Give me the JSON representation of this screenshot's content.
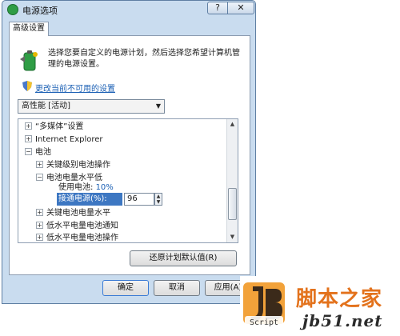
{
  "window": {
    "title": "电源选项",
    "help": "?",
    "close": "✕"
  },
  "tab": {
    "label": "高级设置"
  },
  "description": "选择您要自定义的电源计划，然后选择您希望计算机管理的电源设置。",
  "change_link": "更改当前不可用的设置",
  "plan_select": {
    "selected": "高性能 [活动]"
  },
  "tree": {
    "rows": [
      {
        "expander": "+",
        "label": "“多媒体”设置"
      },
      {
        "expander": "+",
        "label": "Internet Explorer"
      },
      {
        "expander": "−",
        "label": "电池"
      },
      {
        "expander": "+",
        "label": "关键级别电池操作"
      },
      {
        "expander": "−",
        "label": "电池电量水平低"
      }
    ],
    "on_battery": {
      "label": "使用电池:",
      "value": "10%"
    },
    "plugged_in": {
      "label": "接通电源(%):",
      "value": "96"
    },
    "rows_after": [
      {
        "expander": "+",
        "label": "关键电池电量水平"
      },
      {
        "expander": "+",
        "label": "低水平电量电池通知"
      },
      {
        "expander": "+",
        "label": "低水平电量电池操作"
      }
    ]
  },
  "buttons": {
    "restore": "还原计划默认值(R)",
    "ok": "确定",
    "cancel": "取消",
    "apply": "应用(A)"
  },
  "watermark": {
    "text_cn": "脚本之家",
    "url": "jb51.net",
    "logo_text": "Script"
  },
  "colors": {
    "link": "#1a5fb4",
    "selection": "#3d77c2",
    "frame": "#c9dcef",
    "brand": "#e3721c"
  }
}
